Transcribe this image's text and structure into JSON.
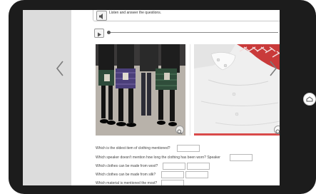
{
  "exercise": {
    "instruction": "Listen and answer the questions."
  },
  "questions": [
    {
      "text": "Which is the oldest item of clothing mentioned?"
    },
    {
      "text": "Which speaker doesn't mention how long the clothing has been worn? Speaker"
    },
    {
      "text": "Which clothes can be made from wool?"
    },
    {
      "text": "Which clothes can be made from silk?"
    },
    {
      "text": "Which material is mentioned the most?"
    }
  ],
  "icons": {
    "speaker": "speaker-icon",
    "play": "play-icon",
    "prev": "chevron-left-icon",
    "next": "chevron-right-icon",
    "zoom": "magnifier-icon",
    "side_button": "home-icon"
  }
}
